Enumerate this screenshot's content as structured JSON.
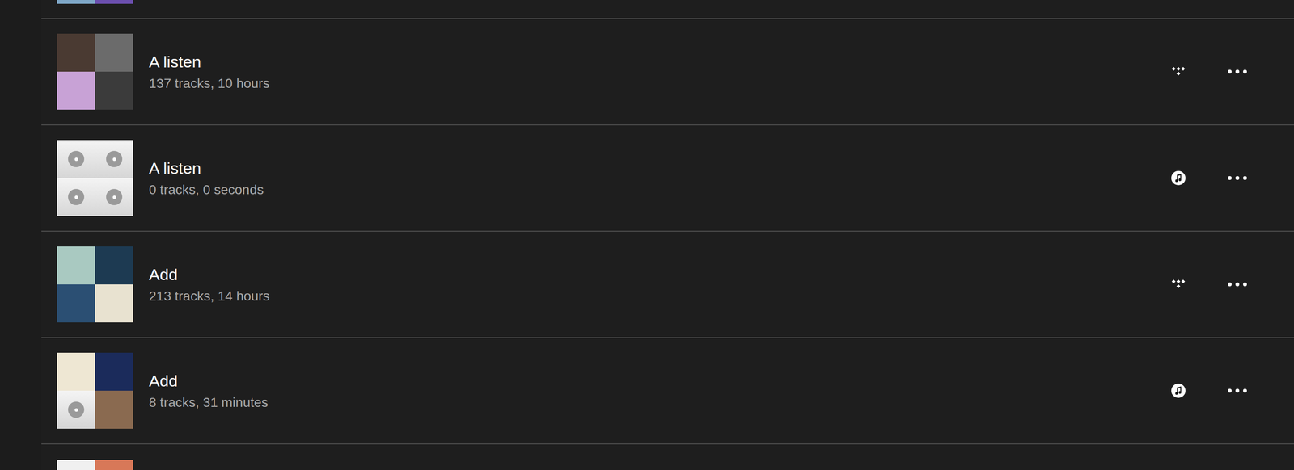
{
  "top_partial_row": {
    "thumbnail": [
      {
        "kind": "art",
        "color": "#7ea6c6"
      },
      {
        "kind": "art",
        "color": "#6b4fae"
      }
    ]
  },
  "playlists": [
    {
      "title": "A listen",
      "subtitle": "137 tracks, 10 hours",
      "source": "tidal",
      "thumbnail": [
        {
          "kind": "art",
          "color": "#4a3a32"
        },
        {
          "kind": "art",
          "color": "#6b6b6b"
        },
        {
          "kind": "art",
          "color": "#c8a2d6"
        },
        {
          "kind": "art",
          "color": "#3b3b3b"
        }
      ]
    },
    {
      "title": "A listen",
      "subtitle": "0 tracks, 0 seconds",
      "source": "apple-music",
      "thumbnail": [
        {
          "kind": "placeholder",
          "color": "#9a9a9a"
        },
        {
          "kind": "placeholder",
          "color": "#9a9a9a"
        },
        {
          "kind": "placeholder",
          "color": "#9a9a9a"
        },
        {
          "kind": "placeholder",
          "color": "#9a9a9a"
        }
      ]
    },
    {
      "title": "Add",
      "subtitle": "213 tracks, 14 hours",
      "source": "tidal",
      "thumbnail": [
        {
          "kind": "art",
          "color": "#a9c9c1"
        },
        {
          "kind": "art",
          "color": "#1d3a52"
        },
        {
          "kind": "art",
          "color": "#2b4f73"
        },
        {
          "kind": "art",
          "color": "#e8e2d0"
        }
      ]
    },
    {
      "title": "Add",
      "subtitle": "8 tracks, 31 minutes",
      "source": "apple-music",
      "thumbnail": [
        {
          "kind": "art",
          "color": "#eee7d3"
        },
        {
          "kind": "art",
          "color": "#1b2b5b"
        },
        {
          "kind": "placeholder",
          "color": "#9a9a9a"
        },
        {
          "kind": "art",
          "color": "#8a6a50"
        }
      ]
    }
  ],
  "bottom_partial_row": {
    "thumbnail": [
      {
        "kind": "art",
        "color": "#f0f0f0"
      },
      {
        "kind": "art",
        "color": "#d87858"
      }
    ]
  }
}
